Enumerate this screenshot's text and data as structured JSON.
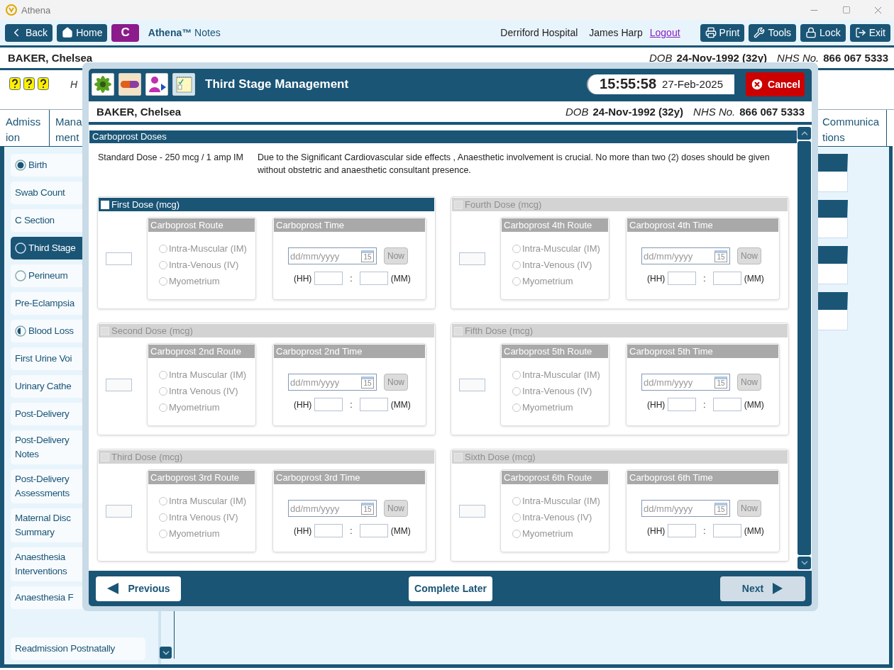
{
  "window": {
    "title": "Athena"
  },
  "toolbar": {
    "left_buttons": [
      {
        "label": "Back",
        "kind": "back"
      },
      {
        "label": "Home",
        "kind": "home"
      },
      {
        "label": "C",
        "kind": "letter"
      }
    ],
    "app_name": "**Athena™** Notes",
    "location": "Derriford Hospital",
    "user": "James Harp",
    "logout": "Logout",
    "right_buttons": [
      {
        "label": "Print",
        "kind": "print"
      },
      {
        "label": "Tools",
        "kind": "tools"
      },
      {
        "label": "Lock",
        "kind": "lock"
      },
      {
        "label": "Exit",
        "kind": "exit"
      }
    ]
  },
  "patient": {
    "name": "BAKER, Chelsea",
    "dob_label": "DOB",
    "dob": "24-Nov-1992 (32y)",
    "nhs_label": "NHS No.",
    "nhs": "866 067 5333"
  },
  "note": "H",
  "tabs": {
    "left": [
      {
        "label": "Admiss\nion"
      },
      {
        "label": "Mana\nment"
      }
    ],
    "right": [
      {
        "label": "Communica\ntions"
      }
    ]
  },
  "sidebar": {
    "items": [
      {
        "label": "Birth",
        "checked": true,
        "partial": false,
        "selected": false
      },
      {
        "label": "Swab Count",
        "selected": false
      },
      {
        "label": "C Section",
        "selected": false
      },
      {
        "label": "Third Stage",
        "checked": false,
        "partial": false,
        "selected": true
      },
      {
        "label": "Perineum",
        "checked": false,
        "partial": false,
        "selected": false
      },
      {
        "label": "Pre-Eclampsia",
        "selected": false
      },
      {
        "label": "Blood Loss",
        "checked": false,
        "partial": true,
        "selected": false
      },
      {
        "label": "First Urine Voi",
        "selected": false
      },
      {
        "label": "Urinary Cathe",
        "selected": false
      },
      {
        "label": "Post-Delivery",
        "selected": false
      },
      {
        "label": "Post-Delivery\nNotes",
        "selected": false
      },
      {
        "label": "Post-Delivery\nAssessments",
        "selected": false
      },
      {
        "label": "Maternal Disc\nSummary",
        "selected": false
      },
      {
        "label": "Anaesthesia\nInterventions",
        "selected": false
      },
      {
        "label": "Anaesthesia F",
        "selected": false
      },
      {
        "label": "Readmission Postnatally",
        "selected": false
      }
    ]
  },
  "modal": {
    "title": "Third Stage Management",
    "time": "15:55:58",
    "date": "27-Feb-2025",
    "cancel": "Cancel",
    "patient": {
      "name": "BAKER, Chelsea",
      "dob_label": "DOB",
      "dob": "24-Nov-1992 (32y)",
      "nhs_label": "NHS No.",
      "nhs": "866 067 5333"
    },
    "section": "Carboprost Doses",
    "standard_dose": "Standard Dose - 250 mcg / 1 amp IM",
    "warning": "Due to the Significant Cardiovascular side effects , Anaesthetic involvement is crucial.  No more than two (2) doses should be given without obstetric and anaesthetic consultant presence.",
    "doses": [
      {
        "title": "First Dose (mcg)",
        "checked": false,
        "disabled": false,
        "inputs_disabled": true,
        "route_title": "Carboprost Route",
        "routes": [
          {
            "label": "Intra-Muscular (IM)",
            "selected": false
          },
          {
            "label": "Intra-Venous (IV)",
            "selected": false
          },
          {
            "label": "Myometrium",
            "selected": false
          }
        ],
        "time_title": "Carboprost Time",
        "date_placeholder": "dd/mm/yyyy",
        "calendar": "15",
        "now": "Now",
        "hh": "(HH)",
        "separator": ":",
        "mm": "(MM)"
      },
      {
        "title": "Fourth Dose (mcg)",
        "checked": false,
        "disabled": true,
        "inputs_disabled": true,
        "route_title": "Carboprost 4th Route",
        "routes": [
          {
            "label": "Intra-Muscular (IM)",
            "selected": false
          },
          {
            "label": "Intra-Venous (IV)",
            "selected": false
          },
          {
            "label": "Myometrium",
            "selected": false
          }
        ],
        "time_title": "Carboprost 4th Time",
        "date_placeholder": "dd/mm/yyyy",
        "calendar": "15",
        "now": "Now",
        "hh": "(HH)",
        "separator": ":",
        "mm": "(MM)"
      },
      {
        "title": "Second Dose (mcg)",
        "checked": false,
        "disabled": true,
        "inputs_disabled": true,
        "route_title": "Carboprost 2nd Route",
        "routes": [
          {
            "label": "Intra Muscular (IM)",
            "selected": false
          },
          {
            "label": "Intra Venous (IV)",
            "selected": false
          },
          {
            "label": "Myometrium",
            "selected": false
          }
        ],
        "time_title": "Carboprost 2nd Time",
        "date_placeholder": "dd/mm/yyyy",
        "calendar": "15",
        "now": "Now",
        "hh": "(HH)",
        "separator": ":",
        "mm": "(MM)"
      },
      {
        "title": "Fifth Dose (mcg)",
        "checked": false,
        "disabled": true,
        "inputs_disabled": true,
        "route_title": "Carboprost 5th Route",
        "routes": [
          {
            "label": "Intra-Muscular (IM)",
            "selected": false
          },
          {
            "label": "Intra-Venous (IV)",
            "selected": false
          },
          {
            "label": "Myometrium",
            "selected": false
          }
        ],
        "time_title": "Carboprost 5th Time",
        "date_placeholder": "dd/mm/yyyy",
        "calendar": "15",
        "now": "Now",
        "hh": "(HH)",
        "separator": ":",
        "mm": "(MM)"
      },
      {
        "title": "Third Dose (mcg)",
        "checked": false,
        "disabled": true,
        "inputs_disabled": true,
        "route_title": "Carboprost 3rd Route",
        "routes": [
          {
            "label": "Intra Muscular (IM)",
            "selected": false
          },
          {
            "label": "Intra Venous (IV)",
            "selected": false
          },
          {
            "label": "Myometrium",
            "selected": false
          }
        ],
        "time_title": "Carboprost 3rd Time",
        "date_placeholder": "dd/mm/yyyy",
        "calendar": "15",
        "now": "Now",
        "hh": "(HH)",
        "separator": ":",
        "mm": "(MM)"
      },
      {
        "title": "Sixth Dose (mcg)",
        "checked": false,
        "disabled": true,
        "inputs_disabled": true,
        "route_title": "Carboprost 6th Route",
        "routes": [
          {
            "label": "Intra-Muscular (IM)",
            "selected": false
          },
          {
            "label": "Intra-Venous (IV)",
            "selected": false
          },
          {
            "label": "Myometrium",
            "selected": false
          }
        ],
        "time_title": "Carboprost 6th Time",
        "date_placeholder": "dd/mm/yyyy",
        "calendar": "15",
        "now": "Now",
        "hh": "(HH)",
        "separator": ":",
        "mm": "(MM)"
      }
    ],
    "footer": [
      {
        "label": "Previous",
        "kind": "previous",
        "disabled": false
      },
      {
        "label": "Complete Later",
        "kind": "plain",
        "disabled": false
      },
      {
        "label": "Next",
        "kind": "next",
        "disabled": true
      }
    ]
  }
}
